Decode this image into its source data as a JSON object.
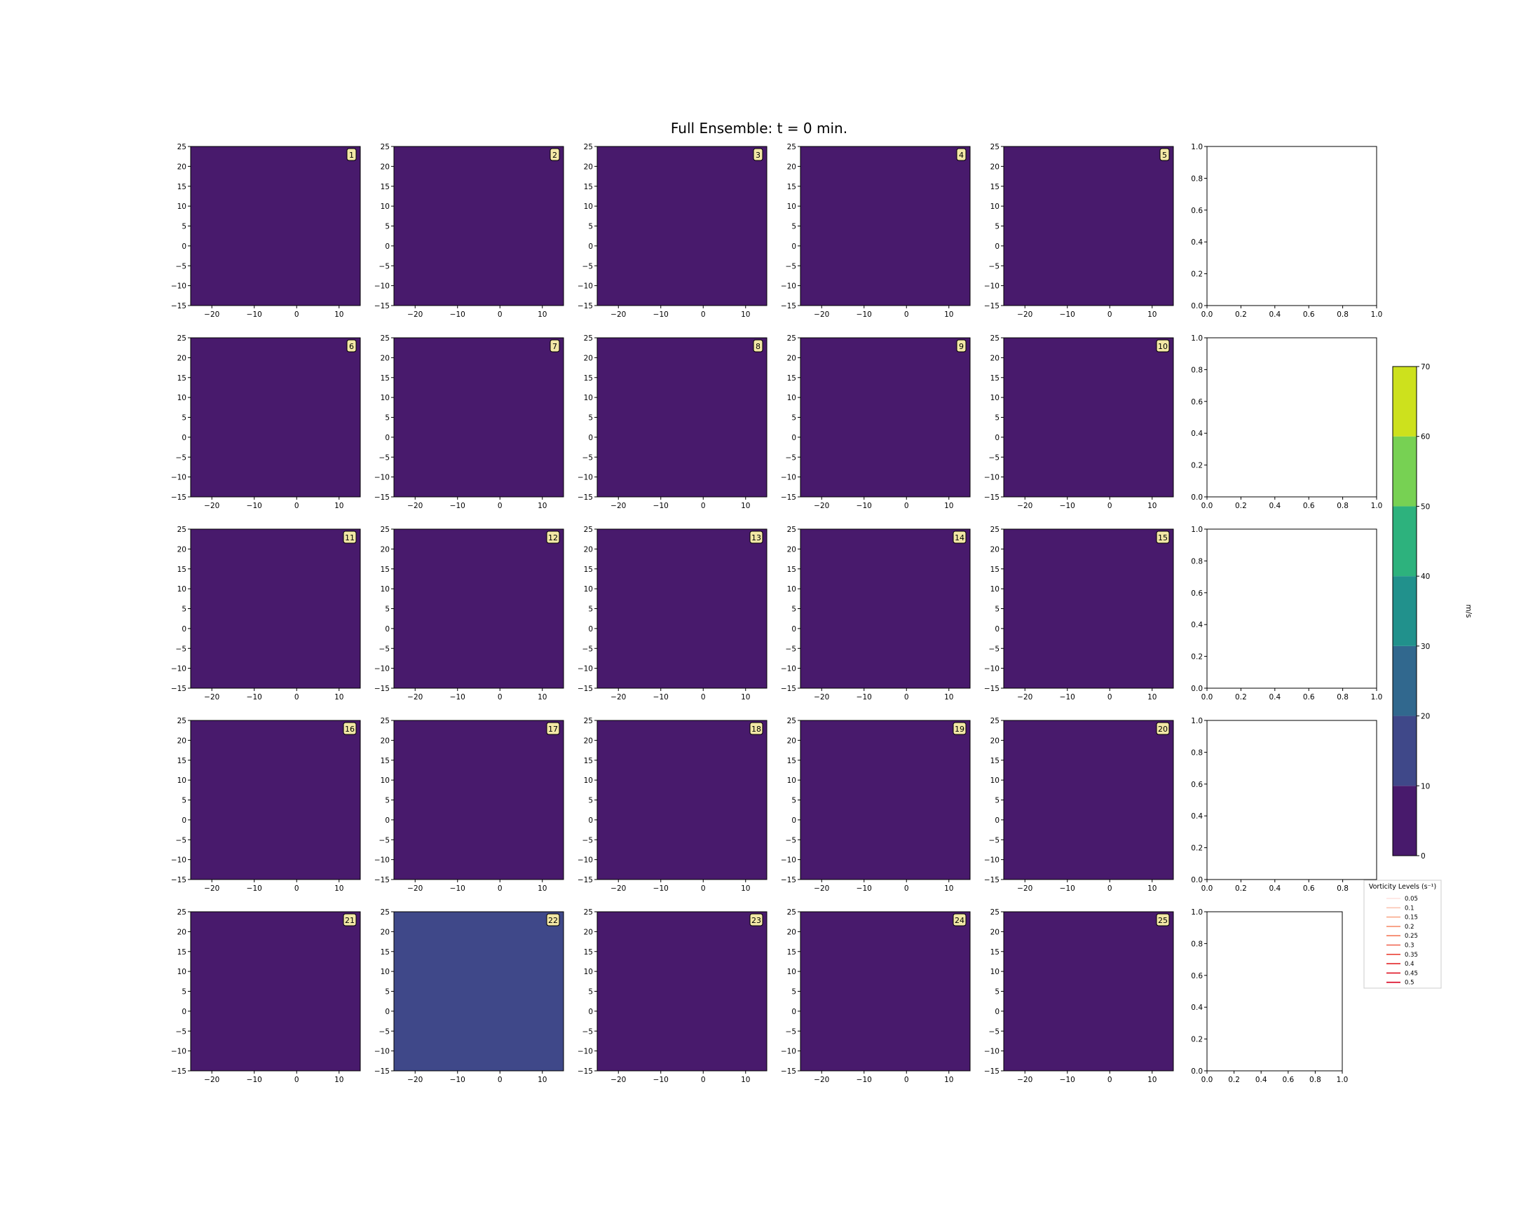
{
  "title": "Full Ensemble: t = 0 min.",
  "colors": {
    "background_field": "#481a6c",
    "member_22_field": "#3f4889",
    "badge_fill": "#f3e8a6"
  },
  "colorbar": {
    "label": "m/s",
    "ticks": [
      "0",
      "10",
      "20",
      "30",
      "40",
      "50",
      "60",
      "70"
    ],
    "levels": [
      0,
      10,
      20,
      30,
      40,
      50,
      60,
      70
    ],
    "colors": [
      "#481a6c",
      "#3f4889",
      "#31688e",
      "#21918c",
      "#2db27d",
      "#77d153",
      "#cde11d"
    ]
  },
  "legend": {
    "title": "Vorticity Levels (s⁻¹)",
    "entries": [
      "0.05",
      "0.1",
      "0.15",
      "0.2",
      "0.25",
      "0.3",
      "0.35",
      "0.4",
      "0.45",
      "0.5"
    ],
    "colors": [
      "#fde0dd",
      "#fbc4b3",
      "#f9a98a",
      "#f78f6e",
      "#f47a5a",
      "#f0604a",
      "#ea4438",
      "#e2262a",
      "#df1424",
      "#d9001e"
    ]
  },
  "chart_data": {
    "type": "heatmap",
    "title": "Full Ensemble: t = 0 min.",
    "members": [
      {
        "label": "1",
        "value_range": [
          0,
          10
        ]
      },
      {
        "label": "2",
        "value_range": [
          0,
          10
        ]
      },
      {
        "label": "3",
        "value_range": [
          0,
          10
        ]
      },
      {
        "label": "4",
        "value_range": [
          0,
          10
        ]
      },
      {
        "label": "5",
        "value_range": [
          0,
          10
        ]
      },
      {
        "label": "6",
        "value_range": [
          0,
          10
        ]
      },
      {
        "label": "7",
        "value_range": [
          0,
          10
        ]
      },
      {
        "label": "8",
        "value_range": [
          0,
          10
        ]
      },
      {
        "label": "9",
        "value_range": [
          0,
          10
        ]
      },
      {
        "label": "10",
        "value_range": [
          0,
          10
        ]
      },
      {
        "label": "11",
        "value_range": [
          0,
          10
        ]
      },
      {
        "label": "12",
        "value_range": [
          0,
          10
        ]
      },
      {
        "label": "13",
        "value_range": [
          0,
          10
        ]
      },
      {
        "label": "14",
        "value_range": [
          0,
          10
        ]
      },
      {
        "label": "15",
        "value_range": [
          0,
          10
        ]
      },
      {
        "label": "16",
        "value_range": [
          0,
          10
        ]
      },
      {
        "label": "17",
        "value_range": [
          0,
          10
        ]
      },
      {
        "label": "18",
        "value_range": [
          0,
          10
        ]
      },
      {
        "label": "19",
        "value_range": [
          0,
          10
        ]
      },
      {
        "label": "20",
        "value_range": [
          0,
          10
        ]
      },
      {
        "label": "21",
        "value_range": [
          0,
          10
        ]
      },
      {
        "label": "22",
        "value_range": [
          10,
          20
        ]
      },
      {
        "label": "23",
        "value_range": [
          0,
          10
        ]
      },
      {
        "label": "24",
        "value_range": [
          0,
          10
        ]
      },
      {
        "label": "25",
        "value_range": [
          0,
          10
        ]
      }
    ],
    "xlim": [
      -25,
      15
    ],
    "ylim": [
      -15,
      25
    ],
    "xticks": [
      "−20",
      "−10",
      "0",
      "10"
    ],
    "yticks": [
      "25",
      "20",
      "15",
      "10",
      "5",
      "0",
      "−5",
      "−10",
      "−15"
    ],
    "empty_axes": {
      "xlim": [
        0,
        1
      ],
      "ylim": [
        0,
        1
      ],
      "ticks": [
        "0.0",
        "0.2",
        "0.4",
        "0.6",
        "0.8",
        "1.0"
      ]
    }
  }
}
